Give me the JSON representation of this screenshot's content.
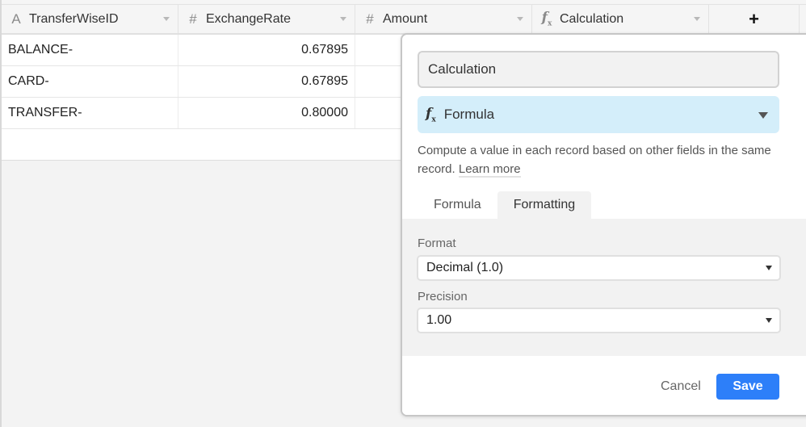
{
  "table": {
    "columns": [
      {
        "icon": "text-field-icon",
        "glyph": "A",
        "label": "TransferWiseID"
      },
      {
        "icon": "number-field-icon",
        "glyph": "#",
        "label": "ExchangeRate"
      },
      {
        "icon": "number-field-icon",
        "glyph": "#",
        "label": "Amount"
      },
      {
        "icon": "formula-field-icon",
        "glyph": "f",
        "label": "Calculation"
      }
    ],
    "add_column_label": "+",
    "rows": [
      {
        "TransferWiseID": "BALANCE-",
        "ExchangeRate": "0.67895"
      },
      {
        "TransferWiseID": "CARD-",
        "ExchangeRate": "0.67895"
      },
      {
        "TransferWiseID": "TRANSFER-",
        "ExchangeRate": "0.80000"
      }
    ]
  },
  "field_editor": {
    "name_value": "Calculation",
    "type_label": "Formula",
    "description": "Compute a value in each record based on other fields in the same record.",
    "learn_more": "Learn more",
    "tabs": [
      {
        "label": "Formula",
        "active": false
      },
      {
        "label": "Formatting",
        "active": true
      }
    ],
    "format_label": "Format",
    "format_value": "Decimal (1.0)",
    "precision_label": "Precision",
    "precision_value": "1.00",
    "cancel_label": "Cancel",
    "save_label": "Save"
  },
  "colors": {
    "accent": "#2d7ff9",
    "type_select_bg": "#d4eefa"
  }
}
